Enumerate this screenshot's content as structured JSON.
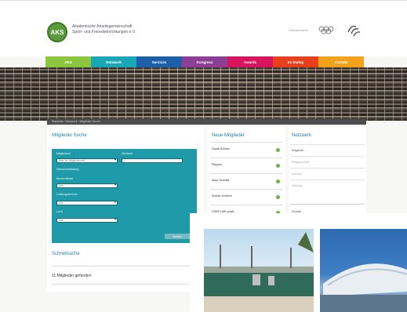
{
  "header": {
    "logo_text": "AKS",
    "org_name_line1": "Akademische Arbeitsgemeinschaft",
    "org_name_line2": "Sport- und Freizeiteinrichtungen e.V.",
    "sponsor_label": "Gefördert durch:"
  },
  "nav": [
    {
      "label": "AKS",
      "color": "#8cc63f",
      "w": 58
    },
    {
      "label": "Netzwerk",
      "color": "#1aa7b5",
      "w": 58
    },
    {
      "label": "Services",
      "color": "#1d5fa8",
      "w": 58
    },
    {
      "label": "Kongress",
      "color": "#8d3f97",
      "w": 58
    },
    {
      "label": "Awards",
      "color": "#d8145c",
      "w": 58
    },
    {
      "label": "Im Dialog",
      "color": "#e8401c",
      "w": 58
    },
    {
      "label": "Kontakt",
      "color": "#f4a21a",
      "w": 58
    }
  ],
  "breadcrumb": "Startseite  ›  Netzwerk  ›  Mitglieder Suche",
  "search": {
    "title": "Mitglieder Suche",
    "label_1": "Mitgliedsart",
    "select_1": "Bitte Art Mitgliedschaft",
    "label_2": "Stichwort",
    "label_3": "Standortaufteilung",
    "label_4": "Bundesländer",
    "select_2": "Alle",
    "label_5": "Leistungsbereich",
    "select_3": "Alle",
    "label_6": "Land",
    "select_4": "Alle",
    "button_label": "Suchen"
  },
  "quick": {
    "title": "Schnellsuche",
    "result": "11 Mitglieder gefunden"
  },
  "members": {
    "title": "Neue Mitglieder",
    "items": [
      "Daniel Bührke",
      "Pfeppen",
      "Aldor Schmidt",
      "Schiller Gmbhm",
      "DSE/FLAIR gmbh"
    ]
  },
  "right": {
    "title": "Netzwerk",
    "items": [
      "Mitglieder",
      "Mitgliedschaft",
      "Anträge",
      "Satzung"
    ],
    "sub": "Kontakt"
  }
}
